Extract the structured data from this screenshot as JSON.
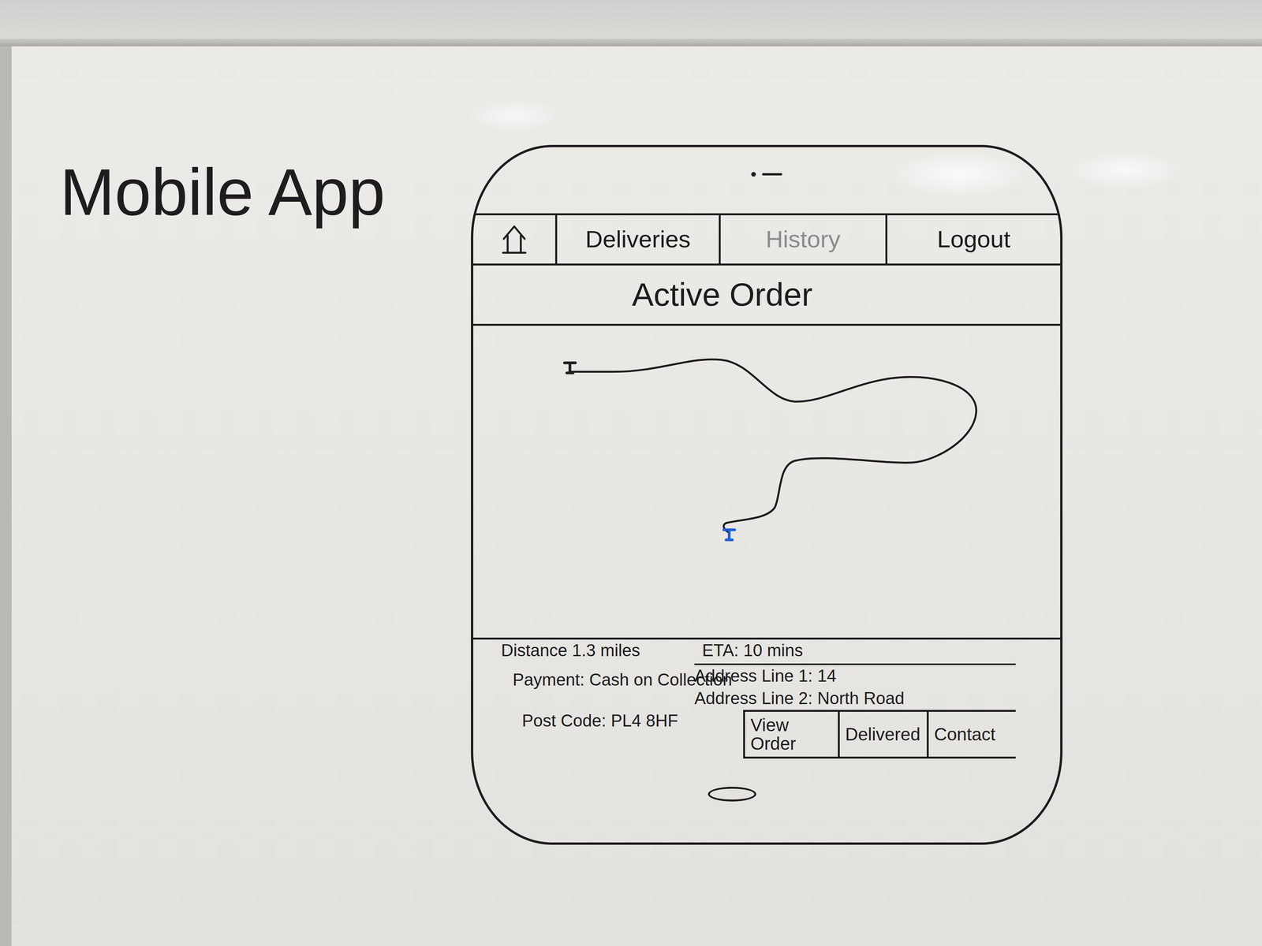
{
  "title": "Mobile App",
  "phone": {
    "nav": {
      "items": [
        {
          "label": "Deliveries",
          "dimmed": false
        },
        {
          "label": "History",
          "dimmed": true
        },
        {
          "label": "Logout",
          "dimmed": false
        }
      ]
    },
    "header": "Active Order",
    "map": {
      "markers": [
        {
          "role": "start",
          "color": "#1f1f1f"
        },
        {
          "role": "end",
          "color": "#1f5fd6"
        }
      ]
    },
    "info": {
      "distance": "Distance 1.3 miles",
      "eta": "ETA: 10 mins",
      "address_line_1": "Address Line 1: 14",
      "address_line_2": "Address Line 2: North Road",
      "post_code": "Post Code: PL4 8HF",
      "payment": "Payment: Cash on Collection"
    },
    "actions": [
      "View Order",
      "Delivered",
      "Contact"
    ]
  }
}
